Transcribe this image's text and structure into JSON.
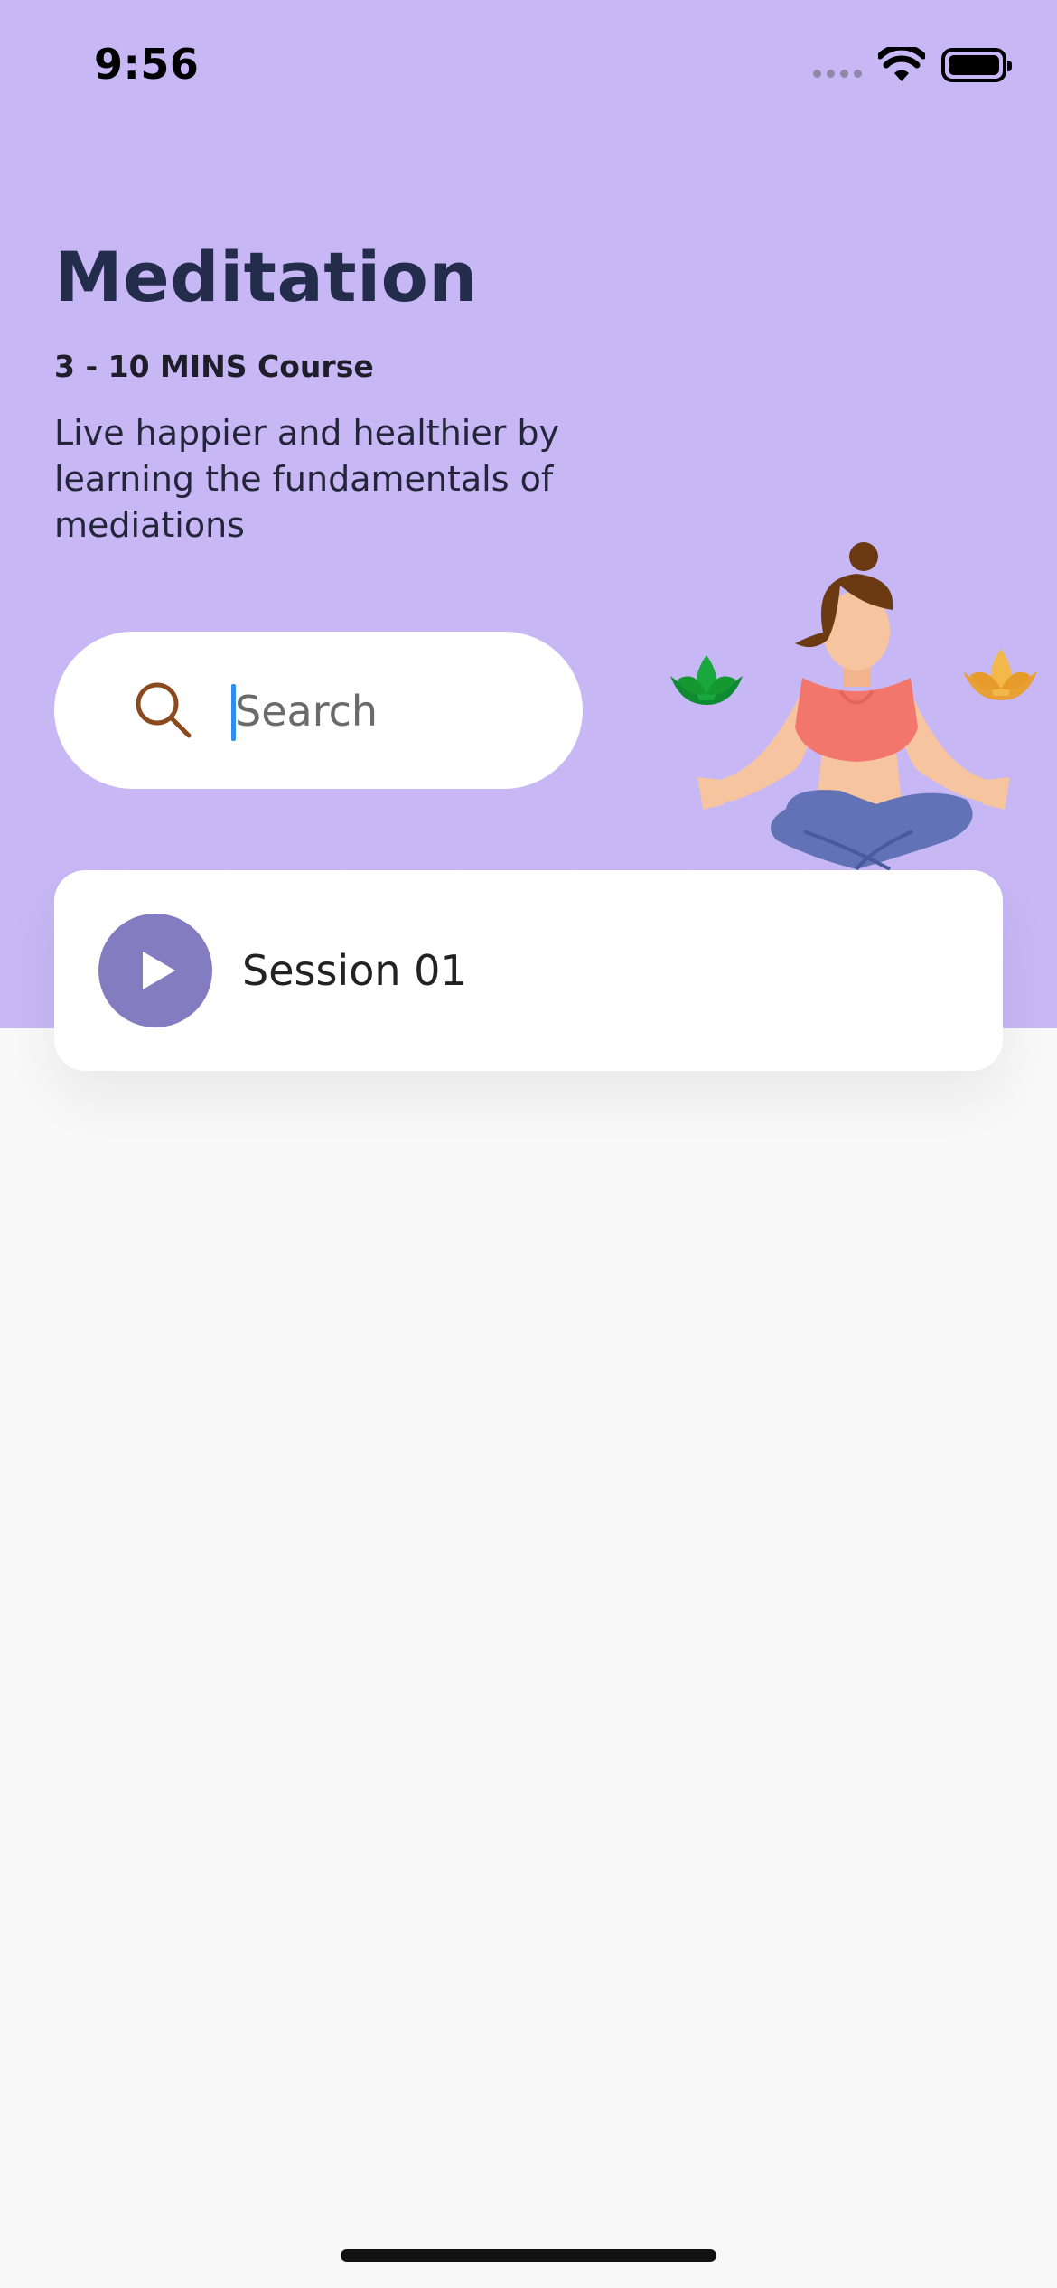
{
  "status_bar": {
    "time": "9:56",
    "icons": [
      "cellular-signal-icon",
      "wifi-icon",
      "battery-icon"
    ]
  },
  "header": {
    "title": "Meditation",
    "subtitle": "3 - 10 MINS Course",
    "description": "Live happier and healthier by learning the fundamentals of mediations"
  },
  "search": {
    "placeholder": "Search",
    "value": "",
    "icon": "search-icon",
    "icon_color": "#8A4A1E"
  },
  "sessions": [
    {
      "label": "Session 01",
      "icon": "play-icon"
    }
  ],
  "colors": {
    "hero_background": "#C7B8F5",
    "page_background": "#F8F8F8",
    "title": "#232C4B",
    "play_button": "#837CC0",
    "caret": "#2F8CF0"
  },
  "illustration": "meditating-woman-illustration"
}
